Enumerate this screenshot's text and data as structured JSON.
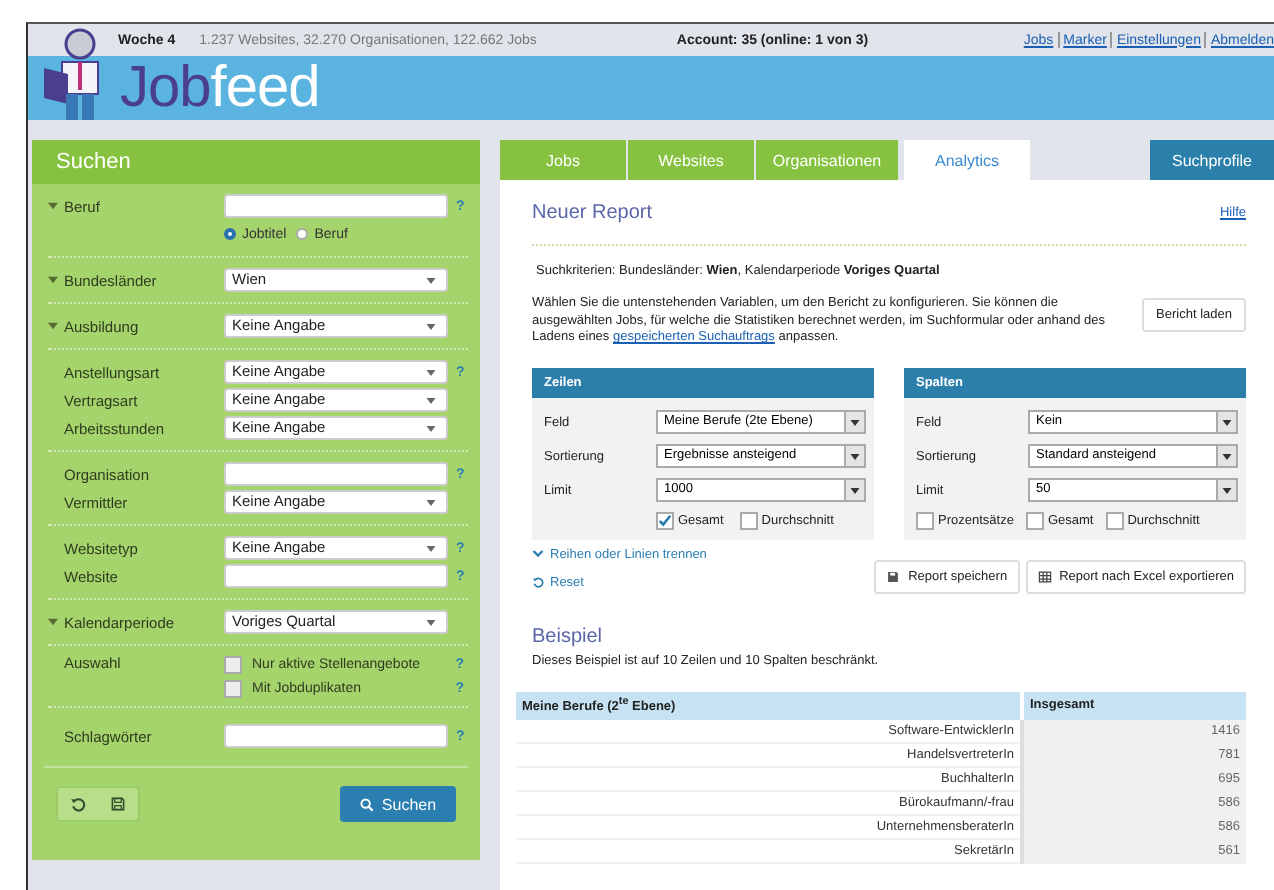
{
  "top_bar": {
    "week": "Woche 4",
    "stats": "1.237 Websites, 32.270 Organisationen, 122.662 Jobs",
    "account": "Account: 35 (online: 1 von 3)",
    "links": [
      "Jobs",
      "Marker",
      "Einstellungen",
      "Abmelden"
    ]
  },
  "logo": {
    "part_1": "Job",
    "part_2": "feed"
  },
  "search_panel": {
    "title": "Suchen",
    "groups": [
      {
        "fields": [
          {
            "kind": "text",
            "label": "Beruf",
            "collapsible": true,
            "help": "?"
          },
          {
            "kind": "radios",
            "options": [
              {
                "label": "Jobtitel",
                "selected": true
              },
              {
                "label": "Beruf",
                "selected": false
              }
            ]
          }
        ]
      },
      {
        "fields": [
          {
            "kind": "select",
            "label": "Bundesländer",
            "collapsible": true,
            "value": "Wien"
          }
        ]
      },
      {
        "fields": [
          {
            "kind": "select",
            "label": "Ausbildung",
            "collapsible": true,
            "value": "Keine Angabe"
          }
        ]
      },
      {
        "fields": [
          {
            "kind": "select",
            "label": "Anstellungsart",
            "collapsible": false,
            "value": "Keine Angabe",
            "help": "?"
          },
          {
            "kind": "select",
            "label": "Vertragsart",
            "collapsible": false,
            "value": "Keine Angabe"
          },
          {
            "kind": "select",
            "label": "Arbeitsstunden",
            "collapsible": false,
            "value": "Keine Angabe"
          }
        ]
      },
      {
        "fields": [
          {
            "kind": "text",
            "label": "Organisation",
            "collapsible": false,
            "help": "?"
          },
          {
            "kind": "select",
            "label": "Vermittler",
            "collapsible": false,
            "value": "Keine Angabe"
          }
        ]
      },
      {
        "fields": [
          {
            "kind": "select",
            "label": "Websitetyp",
            "collapsible": false,
            "value": "Keine Angabe",
            "help": "?"
          },
          {
            "kind": "text",
            "label": "Website",
            "collapsible": false,
            "help": "?"
          }
        ]
      },
      {
        "fields": [
          {
            "kind": "select",
            "label": "Kalendarperiode",
            "collapsible": true,
            "value": "Voriges Quartal"
          }
        ]
      },
      {
        "fields": [
          {
            "kind": "checks",
            "label": "Auswahl",
            "collapsible": false,
            "options": [
              {
                "label": "Nur aktive Stellenangebote",
                "checked": false,
                "help": "?"
              },
              {
                "label": "Mit Jobduplikaten",
                "checked": false,
                "help": "?"
              }
            ]
          }
        ]
      },
      {
        "fields": [
          {
            "kind": "text",
            "label": "Schlagwörter",
            "collapsible": false,
            "help": "?"
          }
        ]
      }
    ],
    "search_button": "Suchen"
  },
  "tabs": [
    {
      "label": "Jobs",
      "selected": false
    },
    {
      "label": "Websites",
      "selected": false
    },
    {
      "label": "Organisationen",
      "selected": false
    },
    {
      "label": "Analytics",
      "selected": true
    }
  ],
  "profiles_button": "Suchprofile",
  "report": {
    "title": "Neuer Report",
    "help_link": "Hilfe",
    "criteria": "Suchkriterien: Bundesländer: **Wien**, Kalendarperiode **Voriges Quartal**",
    "intro": {
      "before": "Wählen Sie die untenstehenden Variablen, um den Bericht zu konfigurieren. Sie können die ausgewählten Jobs, für welche die Statistiken berechnet werden, im Suchformular oder anhand des Ladens eines ",
      "link": "gespeicherten Suchauftrags",
      "after": " anpassen."
    },
    "load_button": "Bericht laden",
    "panels": [
      {
        "title": "Zeilen",
        "fields": [
          {
            "label": "Feld",
            "value": "Meine Berufe (2te Ebene)"
          },
          {
            "label": "Sortierung",
            "value": "Ergebnisse ansteigend"
          },
          {
            "label": "Limit",
            "value": "1000"
          }
        ],
        "options": [
          {
            "label": "Gesamt",
            "checked": true
          },
          {
            "label": "Durchschnitt",
            "checked": false
          }
        ]
      },
      {
        "title": "Spalten",
        "fields": [
          {
            "label": "Feld",
            "value": "Kein"
          },
          {
            "label": "Sortierung",
            "value": "Standard ansteigend"
          },
          {
            "label": "Limit",
            "value": "50"
          }
        ],
        "options": [
          {
            "label": "Prozentsätze",
            "checked": false
          },
          {
            "label": "Gesamt",
            "checked": false
          },
          {
            "label": "Durchschnitt",
            "checked": false
          }
        ]
      }
    ],
    "split_link": "Reihen oder Linien trennen",
    "reset_link": "Reset",
    "save_button": "Report speichern",
    "export_button": "Report nach Excel exportieren"
  },
  "example": {
    "title": "Beispiel",
    "note": "Dieses Beispiel ist auf 10 Zeilen und 10 Spalten beschränkt.",
    "table": {
      "columns": [
        "Meine Berufe (2$^{te}$ Ebene)",
        "Insgesamt"
      ],
      "rows": [
        [
          "Software-EntwicklerIn",
          "1416"
        ],
        [
          "HandelsvertreterIn",
          "781"
        ],
        [
          "BuchhalterIn",
          "695"
        ],
        [
          "Bürokaufmann/-frau",
          "586"
        ],
        [
          "UnternehmensberaterIn",
          "586"
        ],
        [
          "SekretärIn",
          "561"
        ]
      ]
    }
  }
}
